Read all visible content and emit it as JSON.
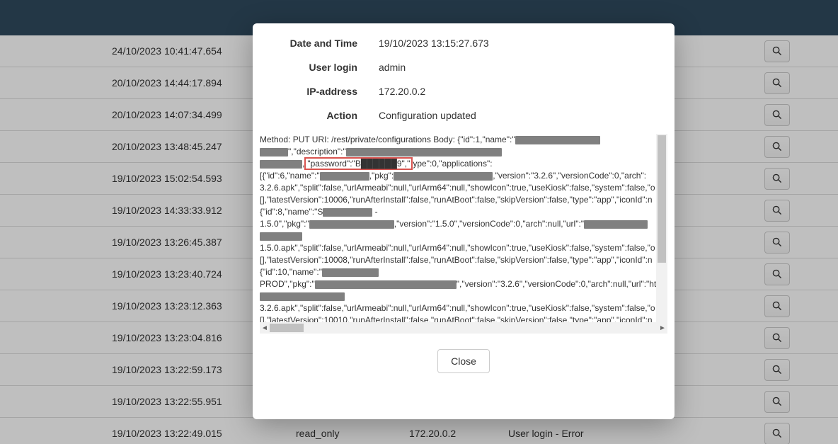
{
  "rows": [
    {
      "datetime": "24/10/2023 10:41:47.654",
      "user": "",
      "ip": "",
      "action": ""
    },
    {
      "datetime": "20/10/2023 14:44:17.894",
      "user": "",
      "ip": "",
      "action": ""
    },
    {
      "datetime": "20/10/2023 14:07:34.499",
      "user": "",
      "ip": "",
      "action": ""
    },
    {
      "datetime": "20/10/2023 13:48:45.247",
      "user": "",
      "ip": "",
      "action": ""
    },
    {
      "datetime": "19/10/2023 15:02:54.593",
      "user": "",
      "ip": "",
      "action": ""
    },
    {
      "datetime": "19/10/2023 14:33:33.912",
      "user": "",
      "ip": "",
      "action": ""
    },
    {
      "datetime": "19/10/2023 13:26:45.387",
      "user": "",
      "ip": "",
      "action": ""
    },
    {
      "datetime": "19/10/2023 13:23:40.724",
      "user": "",
      "ip": "",
      "action": ""
    },
    {
      "datetime": "19/10/2023 13:23:12.363",
      "user": "",
      "ip": "",
      "action": ""
    },
    {
      "datetime": "19/10/2023 13:23:04.816",
      "user": "",
      "ip": "",
      "action": ""
    },
    {
      "datetime": "19/10/2023 13:22:59.173",
      "user": "",
      "ip": "",
      "action": ""
    },
    {
      "datetime": "19/10/2023 13:22:55.951",
      "user": "",
      "ip": "",
      "action": ""
    },
    {
      "datetime": "19/10/2023 13:22:49.015",
      "user": "read_only",
      "ip": "172.20.0.2",
      "action": "User login - Error"
    }
  ],
  "modal": {
    "labels": {
      "datetime": "Date and Time",
      "user": "User login",
      "ip": "IP-address",
      "action": "Action"
    },
    "values": {
      "datetime": "19/10/2023 13:15:27.673",
      "user": "admin",
      "ip": "172.20.0.2",
      "action": "Configuration updated"
    },
    "close_label": "Close",
    "payload": {
      "l1a": "Method: PUT URI: /rest/private/configurations Body: {\"id\":1,\"name\":\"",
      "l2a": "\",\"description\":\"",
      "l3a": ",",
      "highlight": "\"password\":\"B██████9\",\"",
      "l3b": "ype\":0,\"applications\":",
      "l4a": "[{\"id\":6,\"name\":\"",
      "l4b": ",\"pkg\":",
      "l4c": ",\"version\":\"3.2.6\",\"versionCode\":0,\"arch\":",
      "l5": "3.2.6.apk\",\"split\":false,\"urlArmeabi\":null,\"urlArm64\":null,\"showIcon\":true,\"useKiosk\":false,\"system\":false,\"o",
      "l6": "[],\"latestVersion\":10006,\"runAfterInstall\":false,\"runAtBoot\":false,\"skipVersion\":false,\"type\":\"app\",\"iconId\":n",
      "l7a": "{\"id\":8,\"name\":\"S",
      "l7b": " -",
      "l8a": "1.5.0\",\"pkg\":\"",
      "l8b": ",\"version\":\"1.5.0\",\"versionCode\":0,\"arch\":null,\"url\":\"",
      "l10": "1.5.0.apk\",\"split\":false,\"urlArmeabi\":null,\"urlArm64\":null,\"showIcon\":true,\"useKiosk\":false,\"system\":false,\"o",
      "l11": "[],\"latestVersion\":10008,\"runAfterInstall\":false,\"runAtBoot\":false,\"skipVersion\":false,\"type\":\"app\",\"iconId\":n",
      "l12a": "{\"id\":10,\"name\":\"",
      "l13a": "PROD\",\"pkg\":\"",
      "l13b": "\",\"version\":\"3.2.6\",\"versionCode\":0,\"arch\":null,\"url\":\"ht",
      "l15": "3.2.6.apk\",\"split\":false,\"urlArmeabi\":null,\"urlArm64\":null,\"showIcon\":true,\"useKiosk\":false,\"system\":false,\"o",
      "l16": "[],\"latestVersion\":10010,\"runAfterInstall\":false,\"runAtBoot\":false,\"skipVersion\":false,\"type\":\"app\",\"iconId\":n"
    }
  }
}
